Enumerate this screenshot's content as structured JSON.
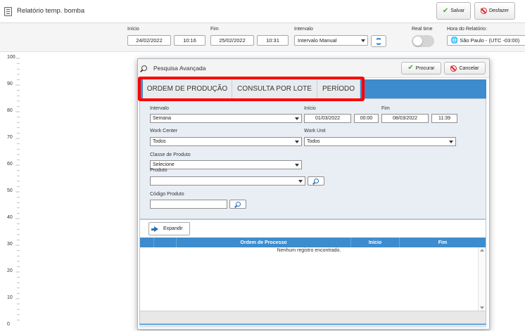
{
  "header": {
    "title": "Relatório temp. bomba",
    "save_label": "Salvar",
    "undo_label": "Desfazer"
  },
  "filters": {
    "start_label": "Início",
    "start_date": "24/02/2022",
    "start_time": "10:16",
    "end_label": "Fim",
    "end_date": "25/02/2022",
    "end_time": "10:31",
    "interval_label": "Intervalo",
    "interval_value": "Intervalo Manual",
    "realtime_label": "Real time",
    "realtime_on": false,
    "timezone_label": "Hora do Relatório:",
    "timezone_value": "São Paulo - (UTC -03:00)"
  },
  "chart": {
    "y_ticks": [
      "100",
      "90",
      "80",
      "70",
      "60",
      "50",
      "40",
      "30",
      "20",
      "10",
      "0"
    ]
  },
  "dialog": {
    "title": "Pesquisa Avançada",
    "search_label": "Procurar",
    "cancel_label": "Cancelar",
    "tabs": [
      {
        "label": "ORDEM DE PRODUÇÃO"
      },
      {
        "label": "CONSULTA POR LOTE"
      },
      {
        "label": "PERÍODO"
      }
    ],
    "form": {
      "interval_label": "Intervalo",
      "interval_value": "Semana",
      "start_label": "Início",
      "start_date": "01/03/2022",
      "start_time": "00:00",
      "end_label": "Fim",
      "end_date": "08/03/2022",
      "end_time": "11:39",
      "work_center_label": "Work Center",
      "work_center_value": "Todos",
      "work_unit_label": "Work Unit",
      "work_unit_value": "Todos",
      "product_class_label": "Classe de Produto",
      "product_class_value": "Selecione",
      "product_label": "Produto",
      "product_value": "",
      "product_code_label": "Código Produto",
      "product_code_value": ""
    },
    "expand_label": "Expandir",
    "grid": {
      "columns": [
        "",
        "",
        "Ordem de Processo",
        "Início",
        "Fim"
      ],
      "empty_message": "Nenhum registro encontrado."
    }
  },
  "colors": {
    "accent_blue": "#3d8ccd",
    "highlight_red": "#ff0000",
    "ok_green": "#4aa33a",
    "cancel_red": "#d9262f"
  }
}
